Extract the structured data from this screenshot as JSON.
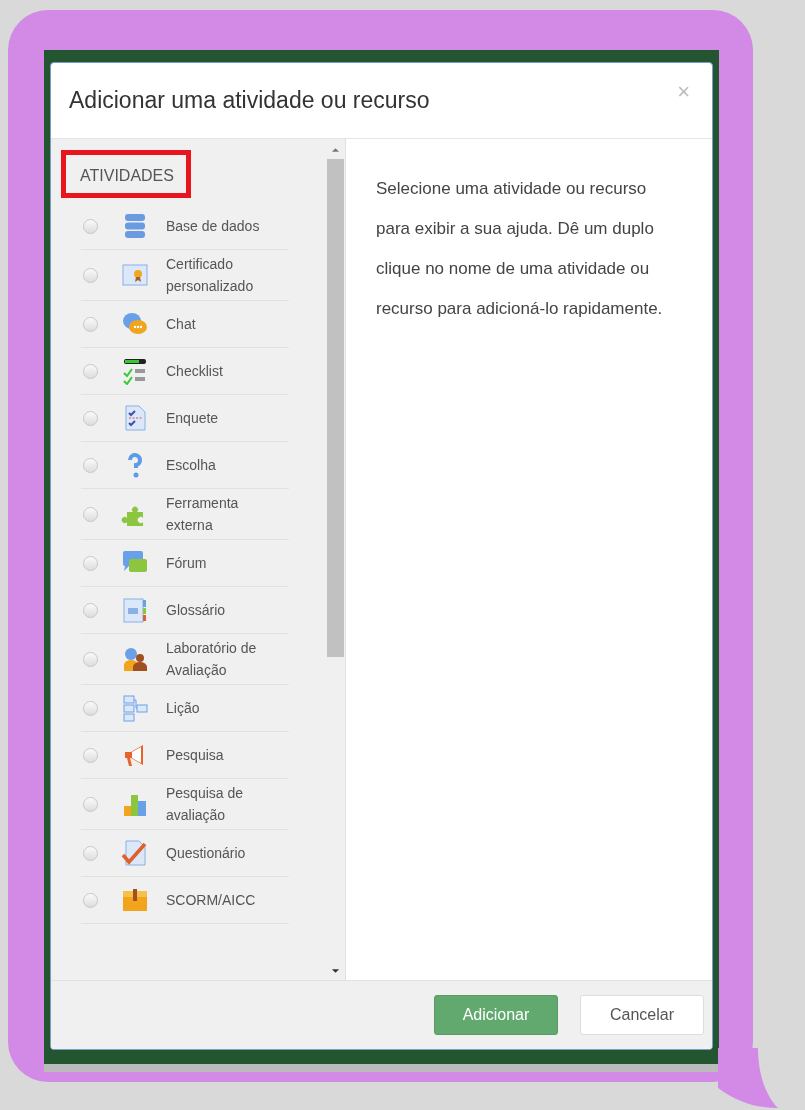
{
  "dialog": {
    "title": "Adicionar uma atividade ou recurso",
    "close": "×"
  },
  "section": {
    "heading": "ATIVIDADES",
    "highlighted": true
  },
  "items": [
    {
      "label": "Base de dados",
      "kind": "database",
      "selected": false
    },
    {
      "label": "Certificado personalizado",
      "kind": "certificate",
      "selected": false
    },
    {
      "label": "Chat",
      "kind": "chat",
      "selected": false
    },
    {
      "label": "Checklist",
      "kind": "checklist",
      "selected": false
    },
    {
      "label": "Enquete",
      "kind": "survey",
      "selected": false
    },
    {
      "label": "Escolha",
      "kind": "question",
      "selected": false
    },
    {
      "label": "Ferramenta externa",
      "kind": "puzzle",
      "selected": false
    },
    {
      "label": "Fórum",
      "kind": "forum",
      "selected": false
    },
    {
      "label": "Glossário",
      "kind": "glossary",
      "selected": false
    },
    {
      "label": "Laboratório de Avaliação",
      "kind": "people",
      "selected": false
    },
    {
      "label": "Lição",
      "kind": "flow",
      "selected": false
    },
    {
      "label": "Pesquisa",
      "kind": "megaphone",
      "selected": false
    },
    {
      "label": "Pesquisa de avaliação",
      "kind": "bars",
      "selected": false
    },
    {
      "label": "Questionário",
      "kind": "quiz",
      "selected": false
    },
    {
      "label": "SCORM/AICC",
      "kind": "package",
      "selected": false
    }
  ],
  "help_text": "Selecione uma atividade ou recurso para exibir a sua ajuda. Dê um duplo clique no nome de uma atividade ou recurso para adicioná-lo rapidamente.",
  "buttons": [
    {
      "label": "Adicionar",
      "kind": "primary"
    },
    {
      "label": "Cancelar",
      "kind": "secondary"
    }
  ]
}
